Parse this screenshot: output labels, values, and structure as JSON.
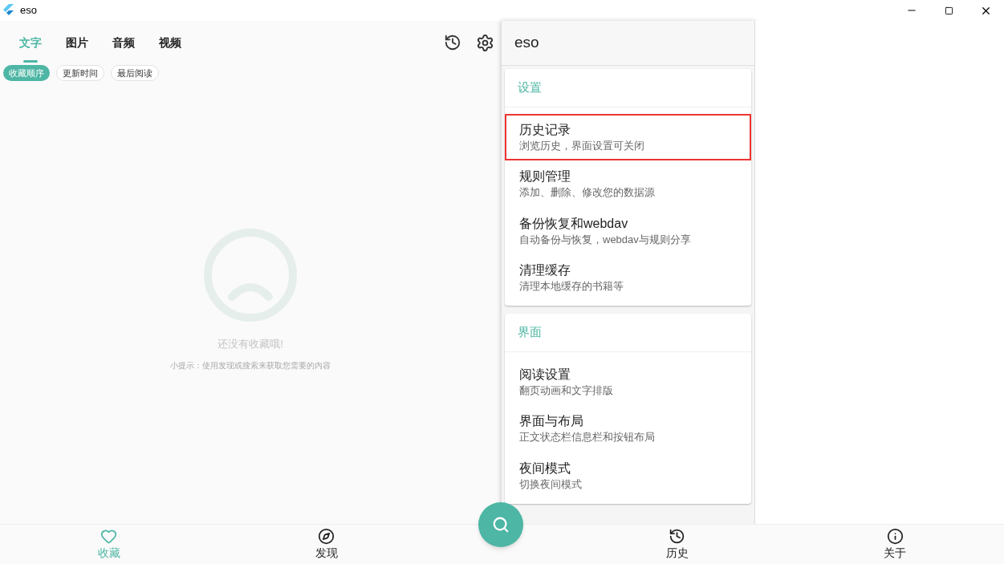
{
  "window": {
    "title": "eso"
  },
  "tabs": [
    {
      "label": "文字",
      "selected": true
    },
    {
      "label": "图片",
      "selected": false
    },
    {
      "label": "音频",
      "selected": false
    },
    {
      "label": "视频",
      "selected": false
    }
  ],
  "sort_chips": [
    {
      "label": "收藏顺序",
      "selected": true
    },
    {
      "label": "更新时间",
      "selected": false
    },
    {
      "label": "最后阅读",
      "selected": false
    }
  ],
  "empty_state": {
    "message": "还没有收藏哦!",
    "hint": "小提示：使用发现或搜索来获取您需要的内容"
  },
  "drawer": {
    "title": "eso",
    "sections": [
      {
        "heading": "设置",
        "items": [
          {
            "title": "历史记录",
            "subtitle": "浏览历史，界面设置可关闭",
            "selected": true
          },
          {
            "title": "规则管理",
            "subtitle": "添加、删除、修改您的数据源",
            "selected": false
          },
          {
            "title": "备份恢复和webdav",
            "subtitle": "自动备份与恢复，webdav与规则分享",
            "selected": false
          },
          {
            "title": "清理缓存",
            "subtitle": "清理本地缓存的书籍等",
            "selected": false
          }
        ]
      },
      {
        "heading": "界面",
        "items": [
          {
            "title": "阅读设置",
            "subtitle": "翻页动画和文字排版",
            "selected": false
          },
          {
            "title": "界面与布局",
            "subtitle": "正文状态栏信息栏和按钮布局",
            "selected": false
          },
          {
            "title": "夜间模式",
            "subtitle": "切换夜间模式",
            "selected": false
          }
        ]
      }
    ]
  },
  "bottom_nav": [
    {
      "label": "收藏",
      "selected": true
    },
    {
      "label": "发现",
      "selected": false
    },
    {
      "label": "历史",
      "selected": false
    },
    {
      "label": "关于",
      "selected": false
    }
  ]
}
